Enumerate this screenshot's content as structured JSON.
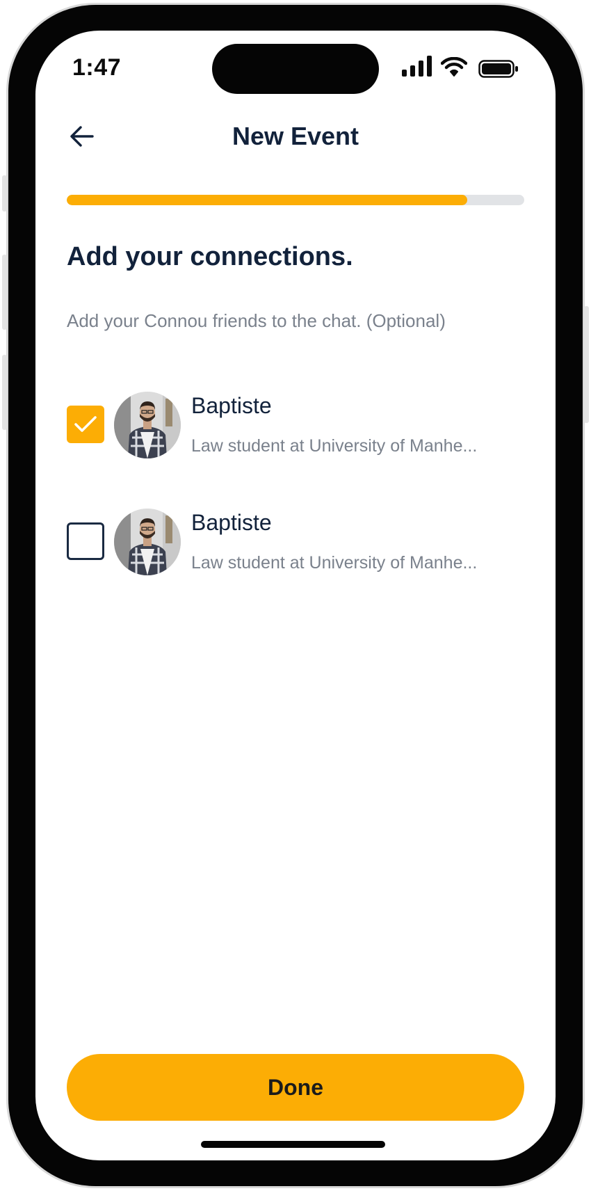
{
  "status_bar": {
    "time": "1:47",
    "icons": [
      "cellular-signal-icon",
      "wifi-icon",
      "battery-icon"
    ]
  },
  "nav": {
    "back_icon": "arrow-left-icon",
    "title": "New Event"
  },
  "progress": {
    "fraction": 0.875,
    "color": "#fcad05",
    "track_color": "#e1e3e6"
  },
  "heading": "Add your connections.",
  "subtext": "Add your Connou friends to the chat. (Optional)",
  "connections": [
    {
      "name": "Baptiste",
      "bio": "Law student at University of Manhe...",
      "checked": true,
      "avatar": "avatar-photo"
    },
    {
      "name": "Baptiste",
      "bio": "Law student at University of Manhe...",
      "checked": false,
      "avatar": "avatar-photo"
    }
  ],
  "done_label": "Done",
  "colors": {
    "accent": "#fcad05",
    "text_primary": "#12223b",
    "text_secondary": "#7a818c"
  }
}
